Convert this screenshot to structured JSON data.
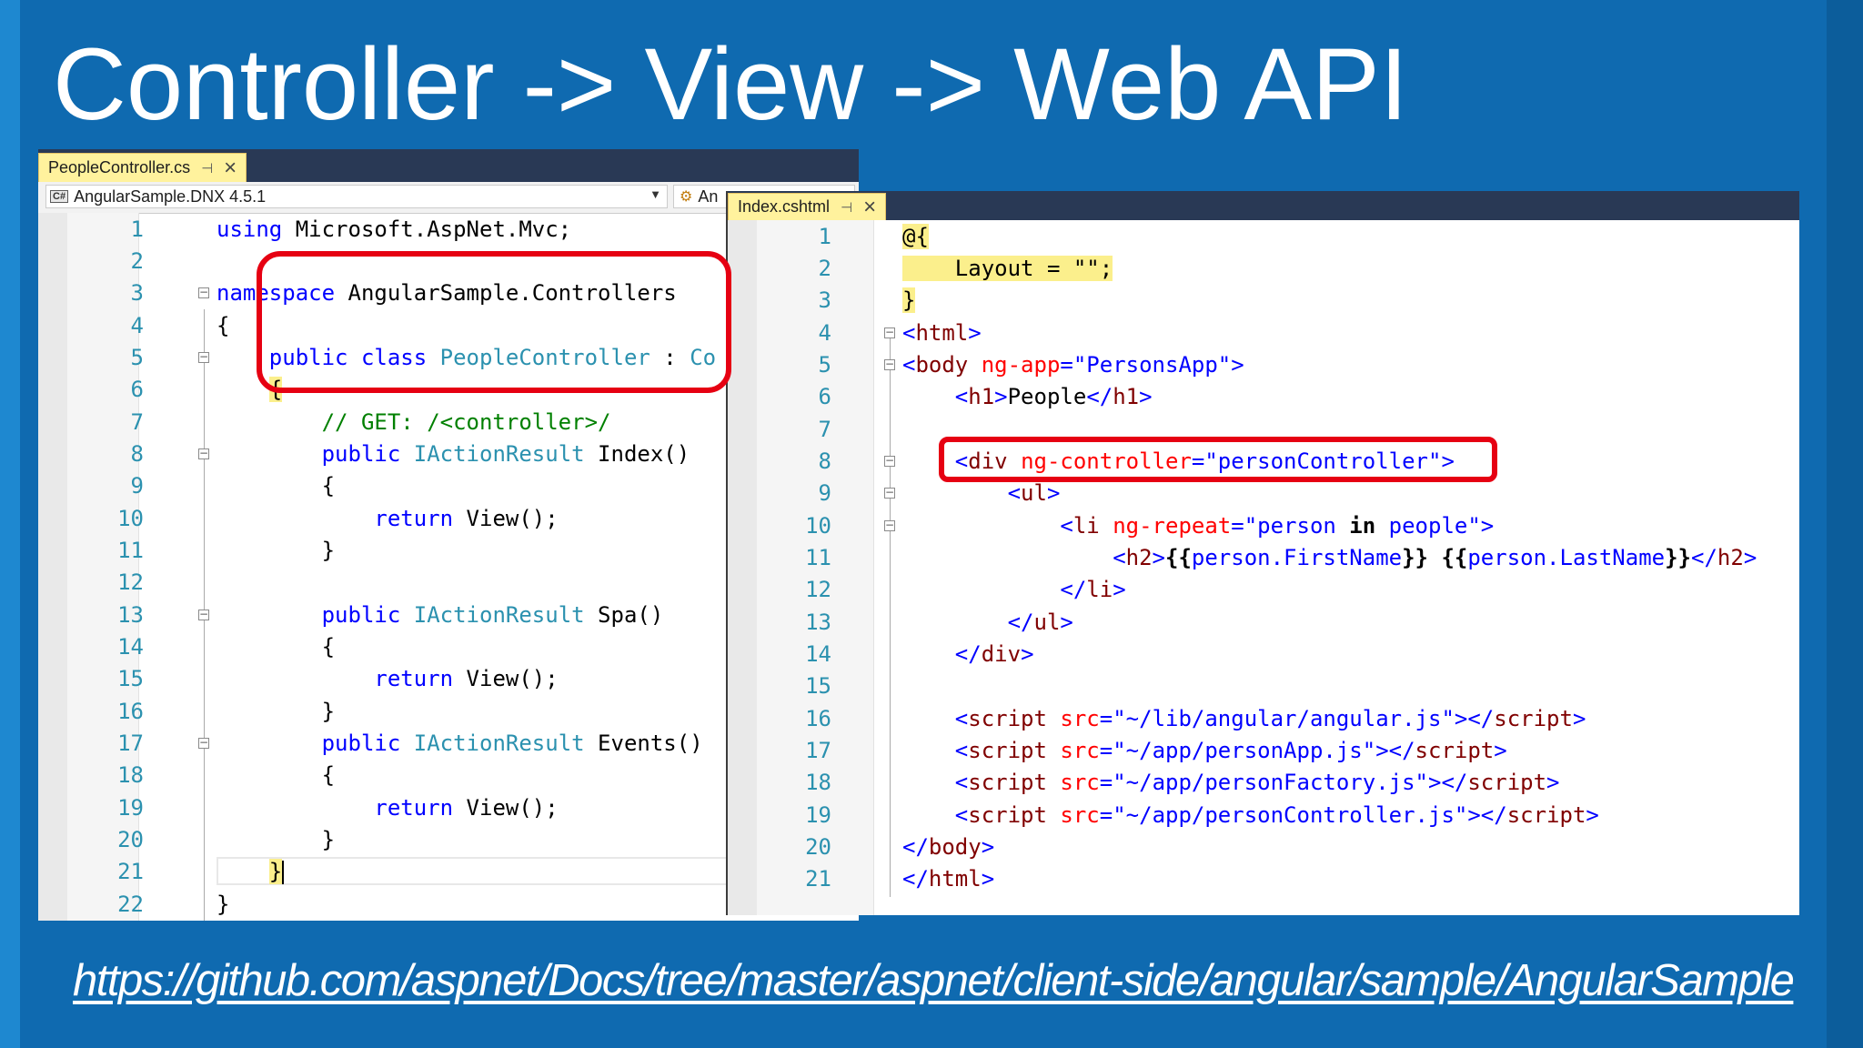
{
  "slide": {
    "title": "Controller -> View -> Web API",
    "link": "https://github.com/aspnet/Docs/tree/master/aspnet/client-side/angular/sample/AngularSample"
  },
  "left_editor": {
    "tab": {
      "label": "PeopleController.cs",
      "pin_glyph": "⊣",
      "close_glyph": "×"
    },
    "project_combo": "AngularSample.DNX 4.5.1",
    "member_combo": "An",
    "line_numbers": [
      "1",
      "2",
      "3",
      "4",
      "5",
      "6",
      "7",
      "8",
      "9",
      "10",
      "11",
      "12",
      "13",
      "14",
      "15",
      "16",
      "17",
      "18",
      "19",
      "20",
      "21",
      "22"
    ]
  },
  "right_editor": {
    "tab": {
      "label": "Index.cshtml",
      "pin_glyph": "⊣",
      "close_glyph": "×"
    },
    "line_numbers": [
      "1",
      "2",
      "3",
      "4",
      "5",
      "6",
      "7",
      "8",
      "9",
      "10",
      "11",
      "12",
      "13",
      "14",
      "15",
      "16",
      "17",
      "18",
      "19",
      "20",
      "21"
    ]
  },
  "colors": {
    "background": "#0f6ab0",
    "keyword": "#0000ff",
    "type": "#2b91af",
    "comment": "#008000",
    "html_tag": "#800000",
    "html_attr": "#ff0000",
    "highlight_box": "#e60012",
    "tab_active": "#fff29d"
  }
}
